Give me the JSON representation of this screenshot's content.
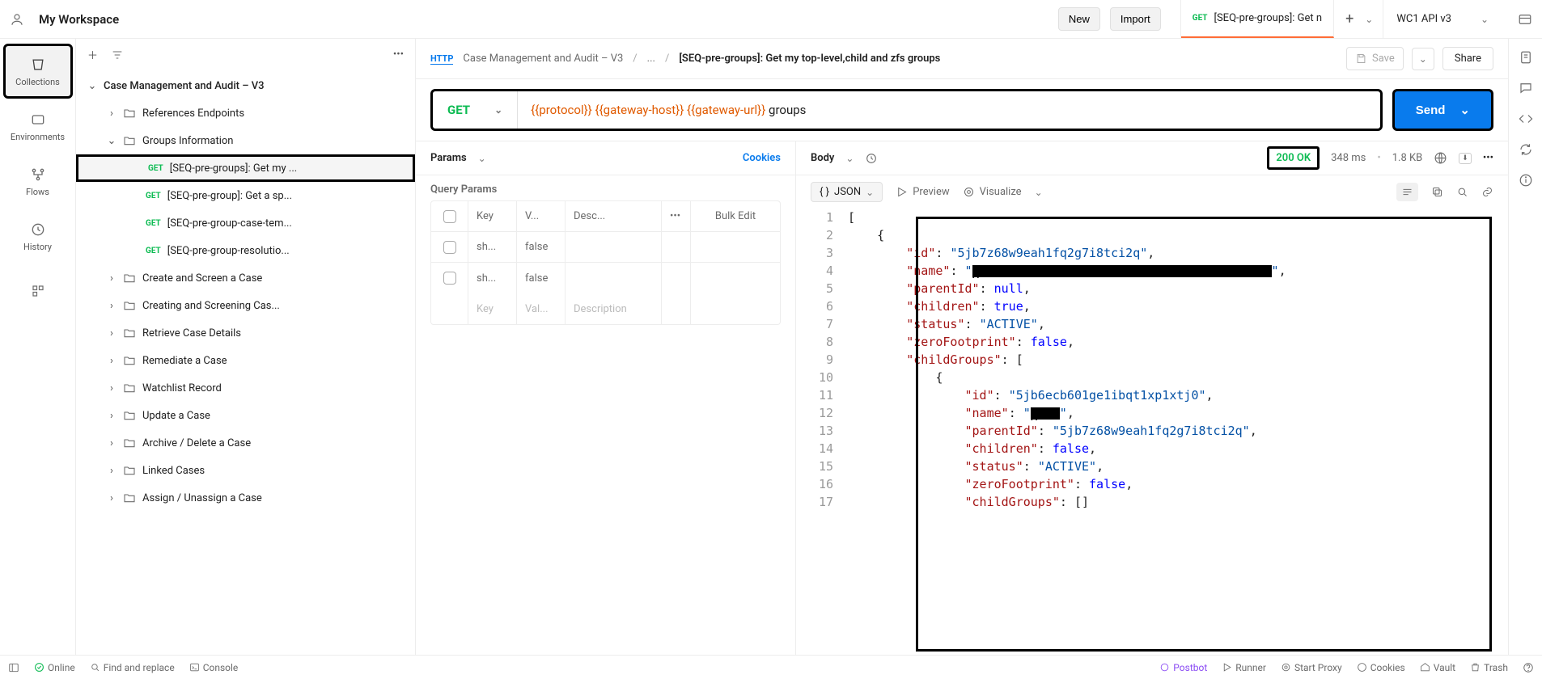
{
  "topbar": {
    "workspace": "My Workspace",
    "new_btn": "New",
    "import_btn": "Import",
    "tab_method": "GET",
    "tab_title": "[SEQ-pre-groups]: Get n",
    "env": "WC1 API v3"
  },
  "rail": {
    "collections": "Collections",
    "environments": "Environments",
    "flows": "Flows",
    "history": "History"
  },
  "sidebar": {
    "root": "Case Management and Audit – V3",
    "folders": [
      {
        "label": "References Endpoints",
        "expanded": false
      },
      {
        "label": "Groups Information",
        "expanded": true,
        "requests": [
          {
            "method": "GET",
            "label": "[SEQ-pre-groups]: Get my ...",
            "selected": true
          },
          {
            "method": "GET",
            "label": "[SEQ-pre-group]: Get a sp..."
          },
          {
            "method": "GET",
            "label": "[SEQ-pre-group-case-tem..."
          },
          {
            "method": "GET",
            "label": "[SEQ-pre-group-resolutio..."
          }
        ]
      },
      {
        "label": "Create and Screen a Case"
      },
      {
        "label": "Creating and Screening Cas..."
      },
      {
        "label": "Retrieve Case Details"
      },
      {
        "label": "Remediate a Case"
      },
      {
        "label": "Watchlist Record"
      },
      {
        "label": "Update a Case"
      },
      {
        "label": "Archive / Delete a Case"
      },
      {
        "label": "Linked Cases"
      },
      {
        "label": "Assign / Unassign a Case"
      }
    ]
  },
  "crumb": {
    "http_badge": "HTTP",
    "c1": "Case Management and Audit – V3",
    "c2": "...",
    "c3": "[SEQ-pre-groups]: Get my top-level,child and zfs groups",
    "save": "Save",
    "share": "Share"
  },
  "url": {
    "method": "GET",
    "var1": "{{protocol}}",
    "var2": "{{gateway-host}}",
    "var3": "{{gateway-url}}",
    "suffix": " groups",
    "send": "Send"
  },
  "req_panel": {
    "tab": "Params",
    "cookies": "Cookies",
    "section": "Query Params",
    "headers": {
      "key": "Key",
      "value": "V...",
      "desc": "Desc...",
      "bulk": "Bulk Edit"
    },
    "rows": [
      {
        "key": "sh...",
        "value": "false"
      },
      {
        "key": "sh...",
        "value": "false"
      }
    ],
    "placeholder": {
      "key": "Key",
      "value": "Val...",
      "desc": "Description"
    }
  },
  "resp_panel": {
    "tab": "Body",
    "status": "200 OK",
    "time": "348 ms",
    "size": "1.8 KB",
    "json_label": "JSON",
    "preview": "Preview",
    "visualize": "Visualize",
    "code": [
      {
        "n": 1,
        "t": "["
      },
      {
        "n": 2,
        "t": "    {"
      },
      {
        "n": 3,
        "t": "        \"id\": \"5jb7z68w9eah1fq2g7i8tci2q\","
      },
      {
        "n": 4,
        "t": "        \"name\": \"<<REDACTED-370>>\","
      },
      {
        "n": 5,
        "t": "        \"parentId\": null,"
      },
      {
        "n": 6,
        "t": "        \"children\": true,"
      },
      {
        "n": 7,
        "t": "        \"status\": \"ACTIVE\","
      },
      {
        "n": 8,
        "t": "        \"zeroFootprint\": false,"
      },
      {
        "n": 9,
        "t": "        \"childGroups\": ["
      },
      {
        "n": 10,
        "t": "            {"
      },
      {
        "n": 11,
        "t": "                \"id\": \"5jb6ecb601ge1ibqt1xp1xtj0\","
      },
      {
        "n": 12,
        "t": "                \"name\": \"<<REDACTED-36>>\","
      },
      {
        "n": 13,
        "t": "                \"parentId\": \"5jb7z68w9eah1fq2g7i8tci2q\","
      },
      {
        "n": 14,
        "t": "                \"children\": false,"
      },
      {
        "n": 15,
        "t": "                \"status\": \"ACTIVE\","
      },
      {
        "n": 16,
        "t": "                \"zeroFootprint\": false,"
      },
      {
        "n": 17,
        "t": "                \"childGroups\": []"
      }
    ]
  },
  "footer": {
    "online": "Online",
    "find": "Find and replace",
    "console": "Console",
    "postbot": "Postbot",
    "runner": "Runner",
    "proxy": "Start Proxy",
    "cookies": "Cookies",
    "vault": "Vault",
    "trash": "Trash"
  }
}
